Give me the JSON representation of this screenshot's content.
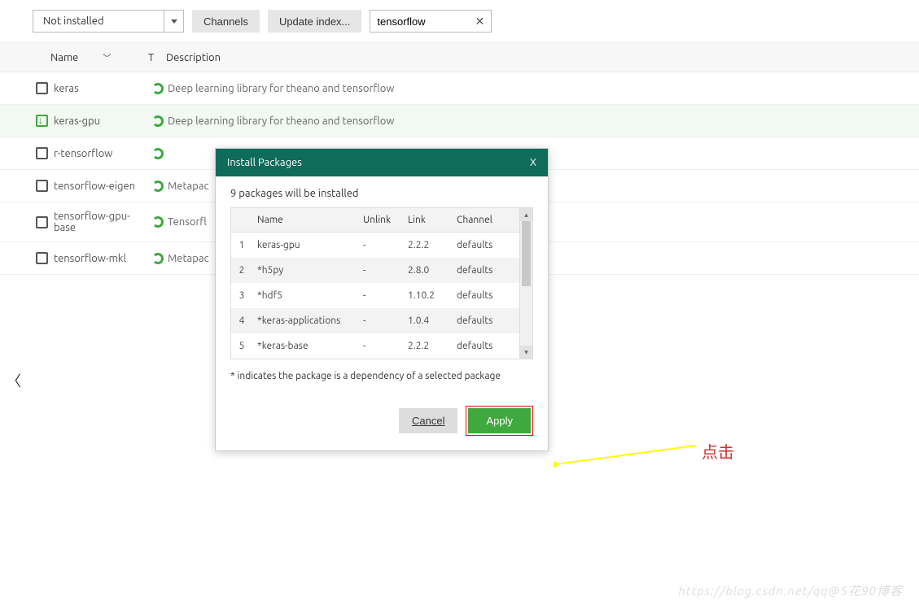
{
  "toolbar": {
    "filter_label": "Not installed",
    "channels_label": "Channels",
    "update_index_label": "Update index...",
    "search_value": "tensorflow"
  },
  "headers": {
    "name": "Name",
    "t": "T",
    "description": "Description"
  },
  "packages": [
    {
      "name": "keras",
      "marked": false,
      "desc": "Deep learning library for theano and tensorflow"
    },
    {
      "name": "keras-gpu",
      "marked": true,
      "desc": "Deep learning library for theano and tensorflow"
    },
    {
      "name": "r-tensorflow",
      "marked": false,
      "desc": ""
    },
    {
      "name": "tensorflow-eigen",
      "marked": false,
      "desc": "Metapac"
    },
    {
      "name": "tensorflow-gpu-base",
      "marked": false,
      "desc": "Tensorfl"
    },
    {
      "name": "tensorflow-mkl",
      "marked": false,
      "desc": "Metapac"
    }
  ],
  "dialog": {
    "title": "Install Packages",
    "close": "X",
    "message": "9 packages will be installed",
    "columns": {
      "name": "Name",
      "unlink": "Unlink",
      "link": "Link",
      "channel": "Channel"
    },
    "rows": [
      {
        "n": "1",
        "name": "keras-gpu",
        "unlink": "-",
        "link": "2.2.2",
        "channel": "defaults"
      },
      {
        "n": "2",
        "name": "*h5py",
        "unlink": "-",
        "link": "2.8.0",
        "channel": "defaults"
      },
      {
        "n": "3",
        "name": "*hdf5",
        "unlink": "-",
        "link": "1.10.2",
        "channel": "defaults"
      },
      {
        "n": "4",
        "name": "*keras-applications",
        "unlink": "-",
        "link": "1.0.4",
        "channel": "defaults"
      },
      {
        "n": "5",
        "name": "*keras-base",
        "unlink": "-",
        "link": "2.2.2",
        "channel": "defaults"
      }
    ],
    "dep_note": "* indicates the package is a dependency of a selected package",
    "cancel": "Cancel",
    "apply": "Apply"
  },
  "annotation": "点击",
  "watermark": "https://blog.csdn.net/qq@5花90博客"
}
